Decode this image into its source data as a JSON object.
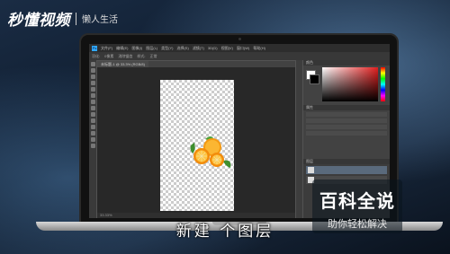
{
  "watermark": {
    "main": "秒懂视频",
    "sub": "懒人生活"
  },
  "photoshop": {
    "logo": "Ps",
    "menu": [
      "文件(F)",
      "编辑(E)",
      "图像(I)",
      "图层(L)",
      "类型(Y)",
      "选择(S)",
      "滤镜(T)",
      "3D(D)",
      "视图(V)",
      "窗口(W)",
      "帮助(H)"
    ],
    "options": [
      "羽化:",
      "0像素",
      "消除锯齿",
      "样式:",
      "正常"
    ],
    "doc_tab": "未标题-1 @ 33.3% (RGB/8)",
    "status": "33.33%",
    "panel_titles": {
      "color": "颜色",
      "properties": "属性",
      "layers": "图层"
    },
    "colors": {
      "accent": "#31a8ff",
      "picker_hue": "#e21f1f"
    }
  },
  "subtitle": "新建  个图层",
  "brand": {
    "line1": "百科全说",
    "line2": "助你轻松解决"
  }
}
